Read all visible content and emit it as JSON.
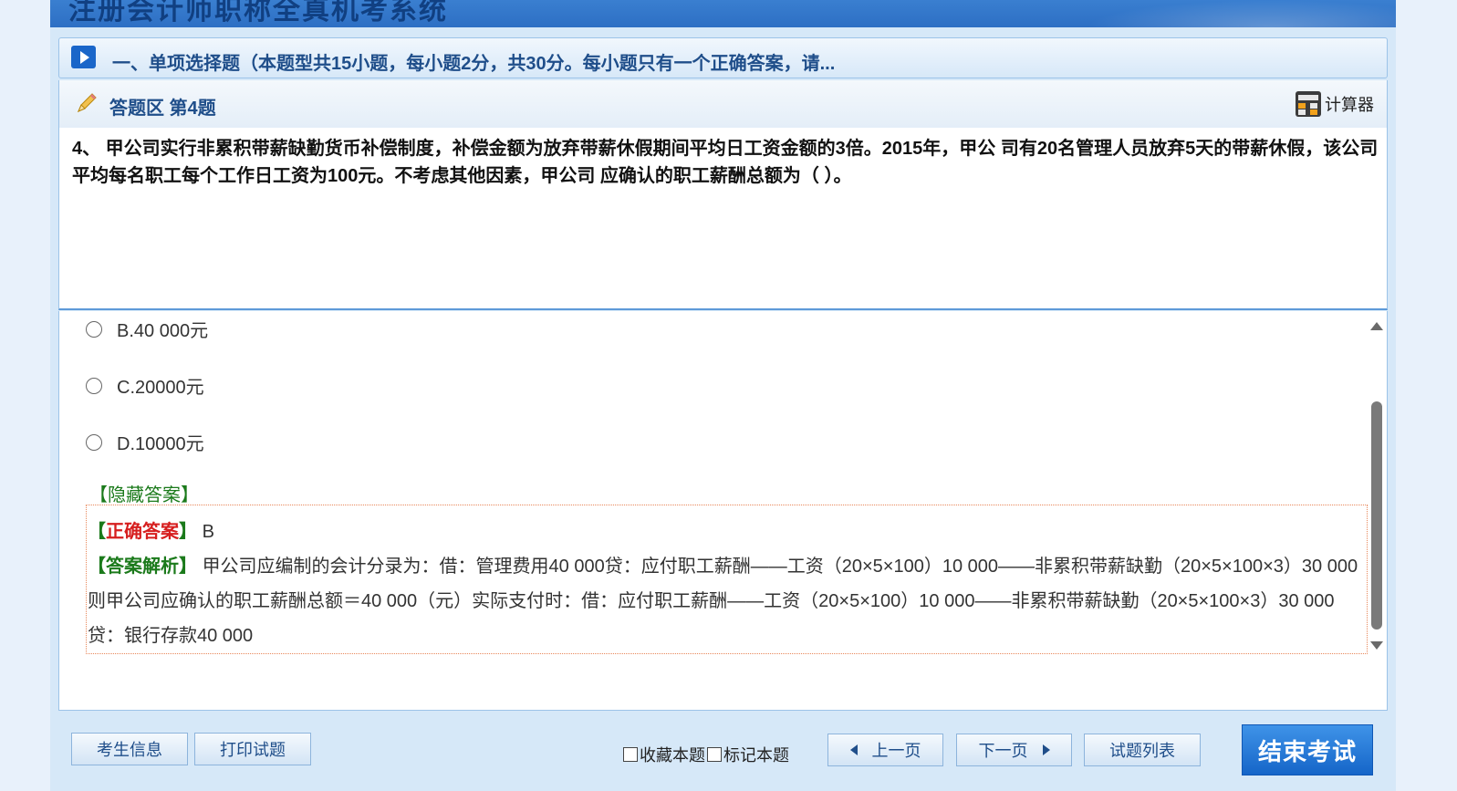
{
  "banner": {
    "title": "注册会计师职称全真机考系统"
  },
  "section": {
    "title": "一、单项选择题（本题型共15小题，每小题2分，共30分。每小题只有一个正确答案，请..."
  },
  "answer_area": {
    "title": "答题区 第4题",
    "calculator_label": "计算器"
  },
  "question": {
    "text": "4、 甲公司实行非累积带薪缺勤货币补偿制度，补偿金额为放弃带薪休假期间平均日工资金额的3倍。2015年，甲公 司有20名管理人员放弃5天的带薪休假，该公司平均每名职工每个工作日工资为100元。不考虑其他因素，甲公司 应确认的职工薪酬总额为（ ）。"
  },
  "options": [
    {
      "label": "B.40 000元"
    },
    {
      "label": "C.20000元"
    },
    {
      "label": "D.10000元"
    }
  ],
  "hide_answer_label": "【隐藏答案】",
  "answer": {
    "bracket_open": "【",
    "bracket_close": "】",
    "correct_label": "正确答案",
    "correct_value": "B",
    "explain_label": "答案解析",
    "explain_text": "甲公司应编制的会计分录为：借：管理费用40 000贷：应付职工薪酬——工资（20×5×100）10 000——非累积带薪缺勤（20×5×100×3）30 000则甲公司应确认的职工薪酬总额＝40 000（元）实际支付时：借：应付职工薪酬——工资（20×5×100）10 000——非累积带薪缺勤（20×5×100×3）30 000贷：银行存款40 000"
  },
  "footer": {
    "student_info": "考生信息",
    "print": "打印试题",
    "favorite": "收藏本题",
    "mark": "标记本题",
    "prev": "上一页",
    "next": "下一页",
    "list": "试题列表",
    "end": "结束考试"
  },
  "colors": {
    "primary_blue": "#1565c8",
    "title_blue": "#1f4e8a",
    "correct_red": "#d61e1e",
    "green": "#1b7a1b"
  }
}
